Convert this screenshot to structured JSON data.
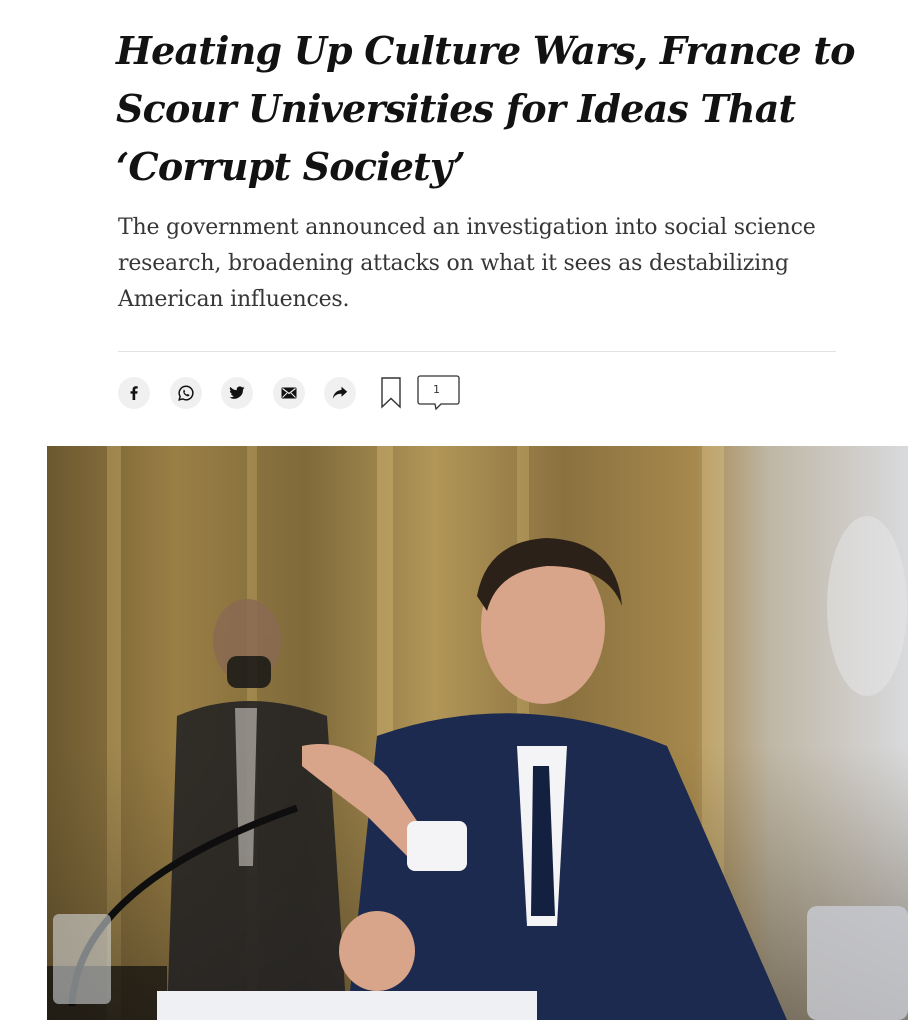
{
  "article": {
    "headline": "Heating Up Culture Wars, France to Scour Universities for Ideas That ‘Corrupt Society’",
    "summary": "The government announced an investigation into social science research, broadening attacks on what it sees as destabilizing American influences."
  },
  "share_bar": {
    "buttons": [
      {
        "icon": "facebook-icon"
      },
      {
        "icon": "whatsapp-icon"
      },
      {
        "icon": "twitter-icon"
      },
      {
        "icon": "email-icon"
      },
      {
        "icon": "share-arrow-icon"
      }
    ],
    "bookmark_icon": "bookmark-icon",
    "comment_icon": "comment-bubble-icon",
    "comment_count": "1"
  },
  "photo": {
    "colors": {
      "wall_gold": "#a88c4f",
      "suit_navy": "#1c2a4f",
      "shirt_white": "#f4f4f6",
      "right_wall": "#d6d7da"
    }
  }
}
